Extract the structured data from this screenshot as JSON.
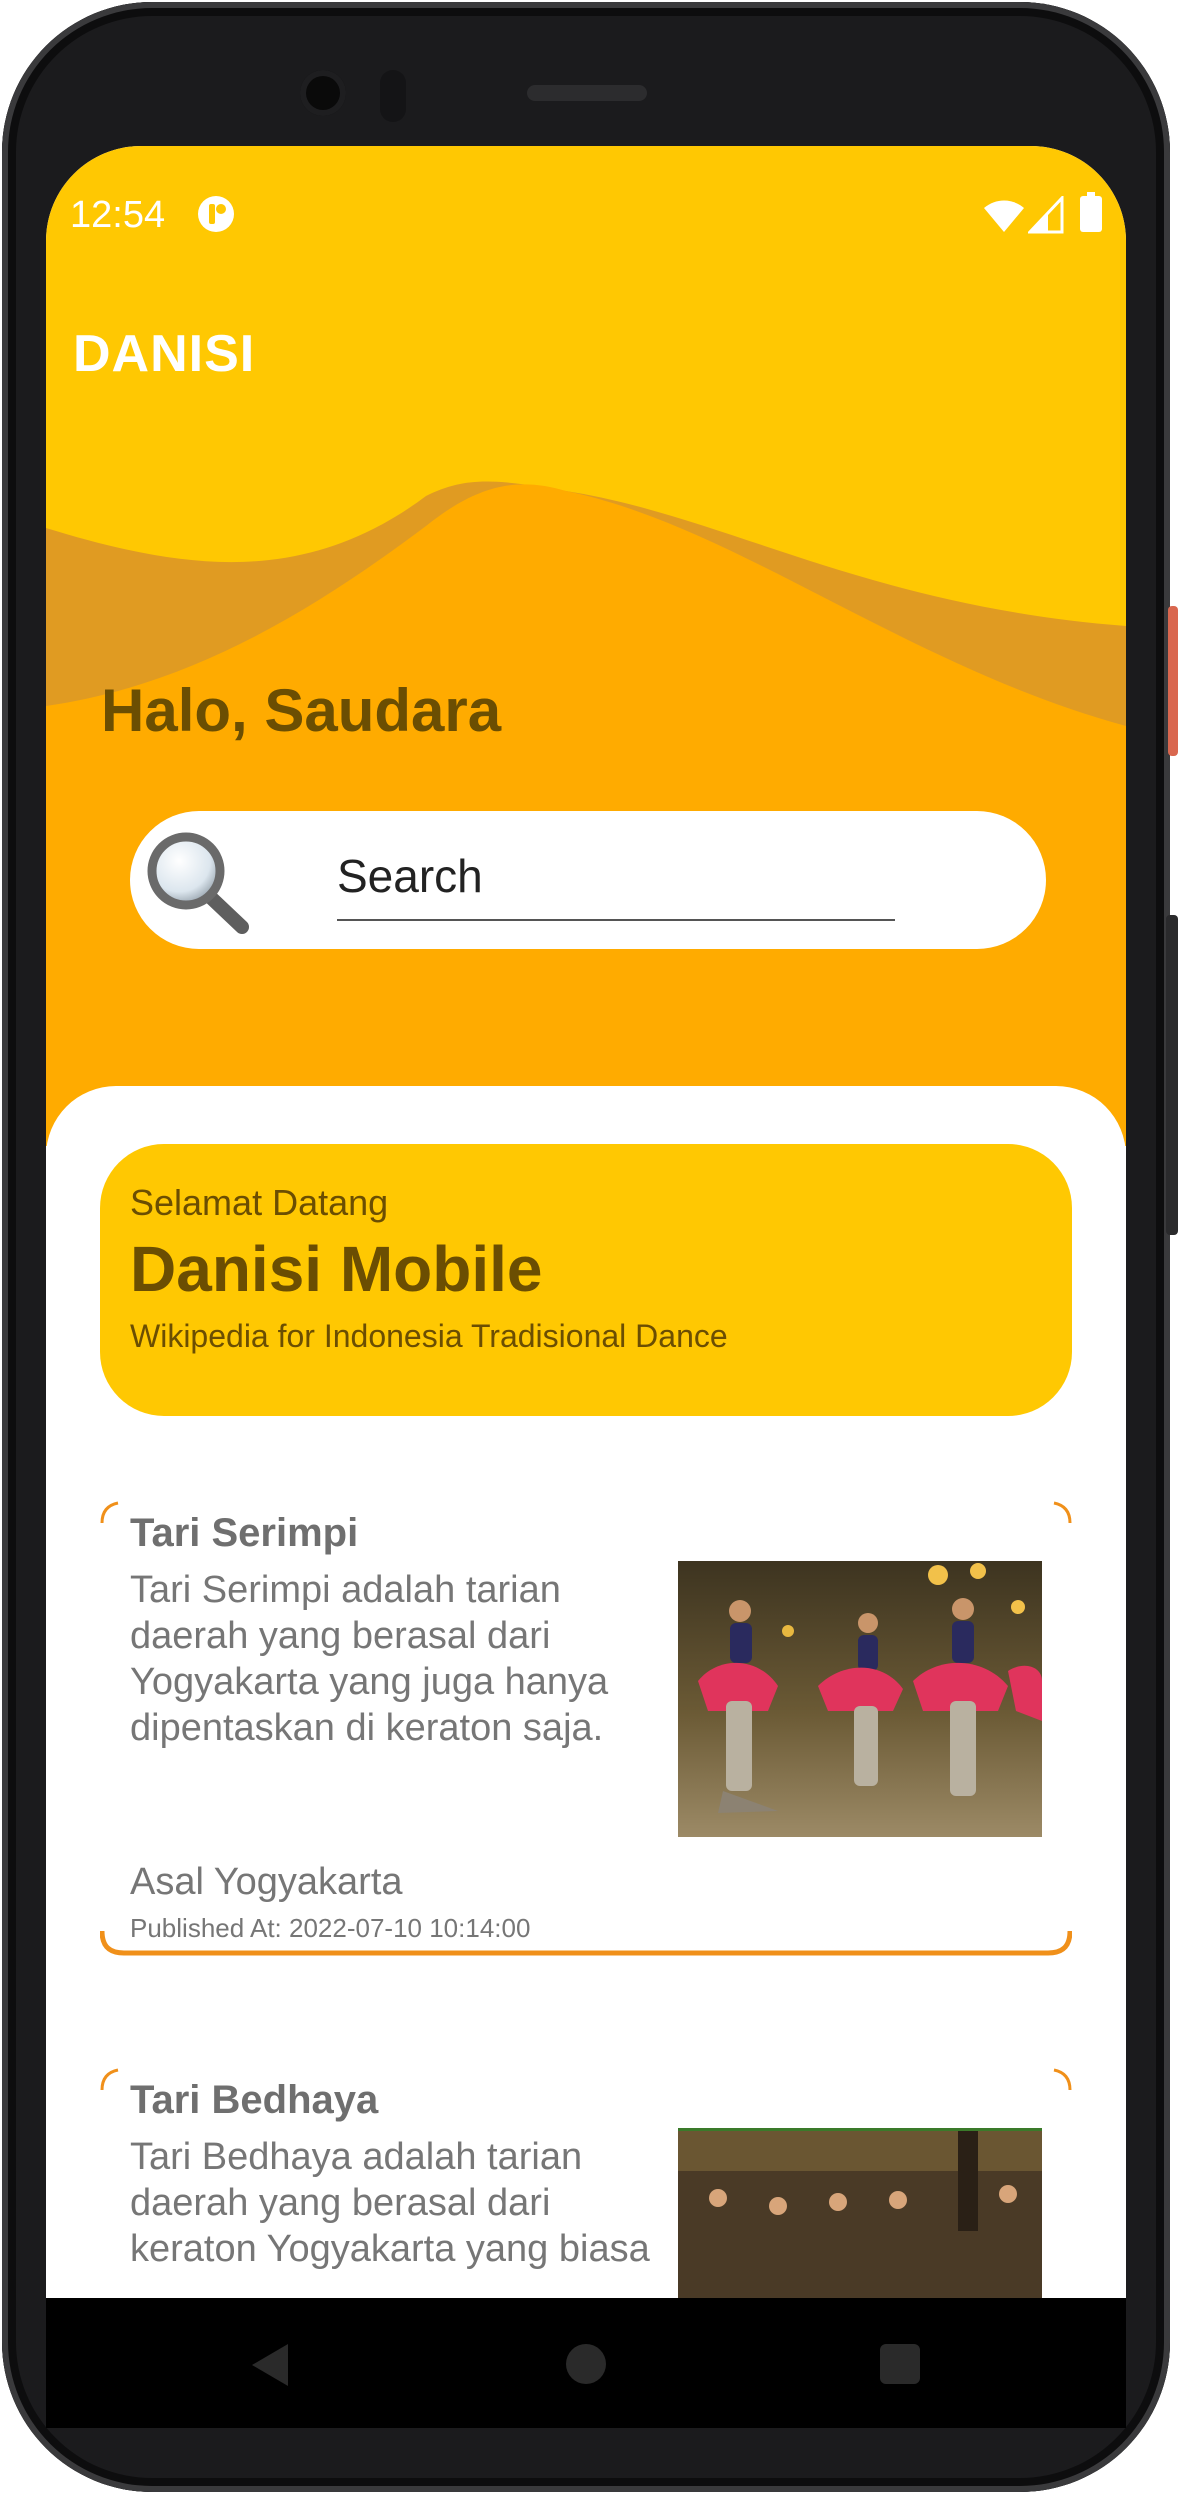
{
  "status_bar": {
    "time": "12:54",
    "icons": [
      "notification-icon",
      "wifi-icon",
      "signal-icon",
      "battery-icon"
    ]
  },
  "app_bar": {
    "title": "DANISI"
  },
  "header": {
    "greeting": "Halo, Saudara"
  },
  "search": {
    "placeholder": "Search",
    "icon": "search-icon"
  },
  "welcome_card": {
    "small": "Selamat Datang",
    "title": "Danisi Mobile",
    "subtitle": "Wikipedia for Indonesia Tradisional Dance"
  },
  "dances": [
    {
      "name": "Tari Serimpi",
      "description": "Tari Serimpi adalah tarian daerah yang berasal dari Yogyakarta yang juga hanya dipentaskan di keraton saja.",
      "origin": "Asal Yogyakarta",
      "published": "Published At: 2022-07-10 10:14:00"
    },
    {
      "name": "Tari Bedhaya",
      "description": "Tari Bedhaya adalah tarian daerah yang berasal dari keraton Yogyakarta yang biasa",
      "origin": "",
      "published": ""
    }
  ],
  "nav_bar": {
    "icons": [
      "back-icon",
      "home-icon",
      "recents-icon"
    ]
  },
  "colors": {
    "primary": "#ffc802",
    "accent_orange": "#ffab00",
    "wave_dark": "#e0a026",
    "text_brown": "#6b4e02",
    "card_border": "#f0901a"
  }
}
